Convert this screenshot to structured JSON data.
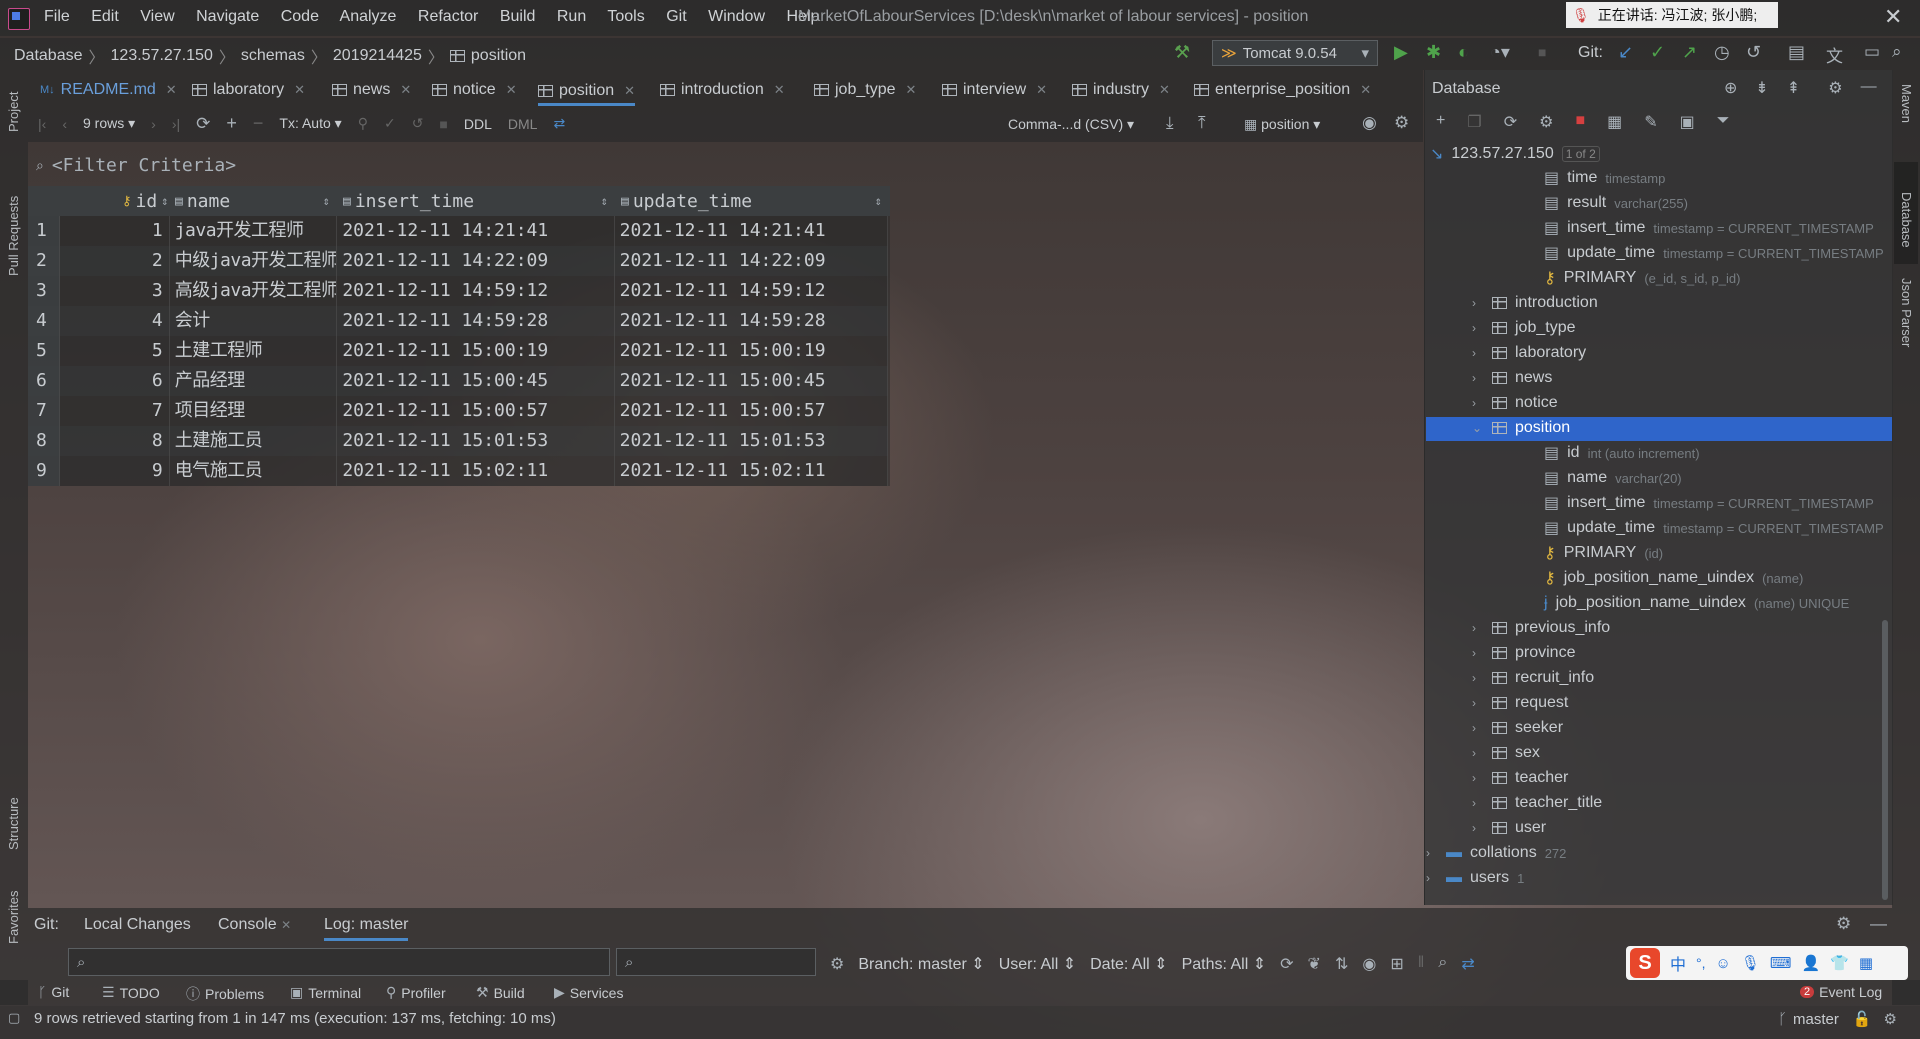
{
  "menu": [
    "File",
    "Edit",
    "View",
    "Navigate",
    "Code",
    "Analyze",
    "Refactor",
    "Build",
    "Run",
    "Tools",
    "Git",
    "Window",
    "Help"
  ],
  "window_title": "MarketOfLabourServices [D:\\desk\\n\\market of labour services] - position",
  "speaking": "正在讲话: 冯江波; 张小鹏;",
  "breadcrumb": [
    "Database",
    "123.57.27.150",
    "schemas",
    "2019214425",
    "position"
  ],
  "run_config": "Tomcat 9.0.54",
  "git_label": "Git:",
  "tabs": [
    {
      "label": "README.md",
      "active": false
    },
    {
      "label": "laboratory",
      "active": false
    },
    {
      "label": "news",
      "active": false
    },
    {
      "label": "notice",
      "active": false
    },
    {
      "label": "position",
      "active": true
    },
    {
      "label": "introduction",
      "active": false
    },
    {
      "label": "job_type",
      "active": false
    },
    {
      "label": "interview",
      "active": false
    },
    {
      "label": "industry",
      "active": false
    },
    {
      "label": "enterprise_position",
      "active": false
    }
  ],
  "grid_toolbar": {
    "rows": "9 rows",
    "tx": "Tx: Auto",
    "ddl": "DDL",
    "dml": "DML",
    "export_format": "Comma-...d (CSV)",
    "table": "position"
  },
  "filter_placeholder": "<Filter Criteria>",
  "table": {
    "columns": [
      "id",
      "name",
      "insert_time",
      "update_time"
    ],
    "rows": [
      [
        "1",
        "1",
        "java开发工程师",
        "2021-12-11 14:21:41",
        "2021-12-11 14:21:41"
      ],
      [
        "2",
        "2",
        "中级java开发工程师",
        "2021-12-11 14:22:09",
        "2021-12-11 14:22:09"
      ],
      [
        "3",
        "3",
        "高级java开发工程师",
        "2021-12-11 14:59:12",
        "2021-12-11 14:59:12"
      ],
      [
        "4",
        "4",
        "会计",
        "2021-12-11 14:59:28",
        "2021-12-11 14:59:28"
      ],
      [
        "5",
        "5",
        "土建工程师",
        "2021-12-11 15:00:19",
        "2021-12-11 15:00:19"
      ],
      [
        "6",
        "6",
        "产品经理",
        "2021-12-11 15:00:45",
        "2021-12-11 15:00:45"
      ],
      [
        "7",
        "7",
        "项目经理",
        "2021-12-11 15:00:57",
        "2021-12-11 15:00:57"
      ],
      [
        "8",
        "8",
        "土建施工员",
        "2021-12-11 15:01:53",
        "2021-12-11 15:01:53"
      ],
      [
        "9",
        "9",
        "电气施工员",
        "2021-12-11 15:02:11",
        "2021-12-11 15:02:11"
      ]
    ]
  },
  "db_panel": {
    "title": "Database",
    "host": "123.57.27.150",
    "host_badge": "1 of 2",
    "tree": [
      {
        "label": "time",
        "sub": "timestamp",
        "kind": "col",
        "indent": 2
      },
      {
        "label": "result",
        "sub": "varchar(255)",
        "kind": "col",
        "indent": 2
      },
      {
        "label": "insert_time",
        "sub": "timestamp = CURRENT_TIMESTAMP",
        "kind": "col",
        "indent": 2
      },
      {
        "label": "update_time",
        "sub": "timestamp = CURRENT_TIMESTAMP",
        "kind": "col",
        "indent": 2
      },
      {
        "label": "PRIMARY",
        "sub": "(e_id, s_id, p_id)",
        "kind": "key",
        "indent": 2
      },
      {
        "label": "introduction",
        "sub": "",
        "kind": "table",
        "indent": 1
      },
      {
        "label": "job_type",
        "sub": "",
        "kind": "table",
        "indent": 1
      },
      {
        "label": "laboratory",
        "sub": "",
        "kind": "table",
        "indent": 1
      },
      {
        "label": "news",
        "sub": "",
        "kind": "table",
        "indent": 1
      },
      {
        "label": "notice",
        "sub": "",
        "kind": "table",
        "indent": 1
      },
      {
        "label": "position",
        "sub": "",
        "kind": "table-open",
        "indent": 1
      },
      {
        "label": "id",
        "sub": "int (auto increment)",
        "kind": "col",
        "indent": 2
      },
      {
        "label": "name",
        "sub": "varchar(20)",
        "kind": "col",
        "indent": 2
      },
      {
        "label": "insert_time",
        "sub": "timestamp = CURRENT_TIMESTAMP",
        "kind": "col",
        "indent": 2
      },
      {
        "label": "update_time",
        "sub": "timestamp = CURRENT_TIMESTAMP",
        "kind": "col",
        "indent": 2
      },
      {
        "label": "PRIMARY",
        "sub": "(id)",
        "kind": "key",
        "indent": 2
      },
      {
        "label": "job_position_name_uindex",
        "sub": "(name)",
        "kind": "key",
        "indent": 2
      },
      {
        "label": "job_position_name_uindex",
        "sub": "(name) UNIQUE",
        "kind": "index",
        "indent": 2
      },
      {
        "label": "previous_info",
        "sub": "",
        "kind": "table",
        "indent": 1
      },
      {
        "label": "province",
        "sub": "",
        "kind": "table",
        "indent": 1
      },
      {
        "label": "recruit_info",
        "sub": "",
        "kind": "table",
        "indent": 1
      },
      {
        "label": "request",
        "sub": "",
        "kind": "table",
        "indent": 1
      },
      {
        "label": "seeker",
        "sub": "",
        "kind": "table",
        "indent": 1
      },
      {
        "label": "sex",
        "sub": "",
        "kind": "table",
        "indent": 1
      },
      {
        "label": "teacher",
        "sub": "",
        "kind": "table",
        "indent": 1
      },
      {
        "label": "teacher_title",
        "sub": "",
        "kind": "table",
        "indent": 1
      },
      {
        "label": "user",
        "sub": "",
        "kind": "table",
        "indent": 1
      },
      {
        "label": "collations",
        "sub": "272",
        "kind": "folder",
        "indent": 0
      },
      {
        "label": "users",
        "sub": "1",
        "kind": "folder",
        "indent": 0
      }
    ]
  },
  "git_panel": {
    "label": "Git:",
    "tabs": [
      "Local Changes",
      "Console",
      "Log: master"
    ],
    "branch": "Branch: master",
    "user": "User: All",
    "date": "Date: All",
    "paths": "Paths: All"
  },
  "bottom_tools": [
    "Git",
    "TODO",
    "Problems",
    "Terminal",
    "Profiler",
    "Build",
    "Services"
  ],
  "event_log": "Event Log",
  "event_count": "2",
  "status_message": "9 rows retrieved starting from 1 in 147 ms (execution: 137 ms, fetching: 10 ms)",
  "status_branch": "master",
  "side_left": [
    "Project",
    "Pull Requests",
    "Structure",
    "Favorites"
  ],
  "side_right": [
    "Maven",
    "Database",
    "Json Parser"
  ],
  "ime": [
    "中",
    "°,"
  ]
}
